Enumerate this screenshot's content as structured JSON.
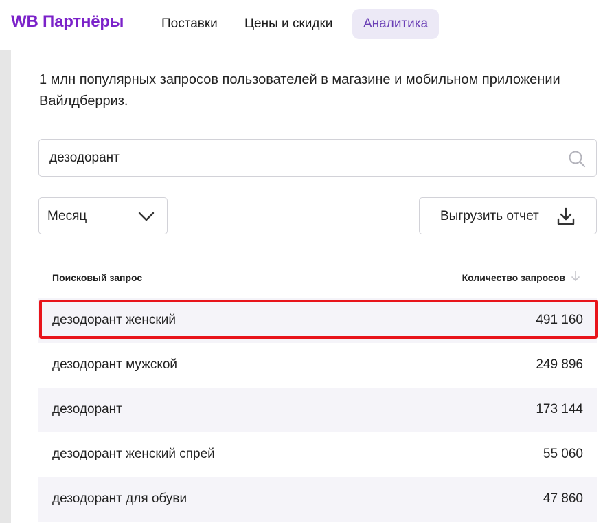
{
  "header": {
    "logo": "WB Партнёры",
    "nav": [
      {
        "label": "Поставки"
      },
      {
        "label": "Цены и скидки"
      },
      {
        "label": "Аналитика",
        "active": true
      }
    ]
  },
  "intro_text": "1 млн популярных запросов пользователей в магазине и мобильном приложении Вайлдберриз.",
  "search": {
    "value": "дезодорант",
    "icon": "search-icon"
  },
  "period_select": {
    "value": "Месяц",
    "icon": "chevron-down-icon"
  },
  "export_button": {
    "label": "Выгрузить отчет",
    "icon": "download-icon"
  },
  "table": {
    "columns": [
      "Поисковый запрос",
      "Количество запросов"
    ],
    "sort_icon": "arrow-down-icon",
    "rows": [
      {
        "query": "дезодорант женский",
        "count": "491 160",
        "highlighted": true
      },
      {
        "query": "дезодорант мужской",
        "count": "249 896"
      },
      {
        "query": "дезодорант",
        "count": "173 144"
      },
      {
        "query": "дезодорант женский спрей",
        "count": "55 060"
      },
      {
        "query": "дезодорант для обуви",
        "count": "47 860"
      }
    ]
  },
  "colors": {
    "brand": "#7b22c9",
    "active_nav_bg": "#ece9f6",
    "highlight_border": "#e8141b",
    "row_shade": "#f5f4f9"
  }
}
